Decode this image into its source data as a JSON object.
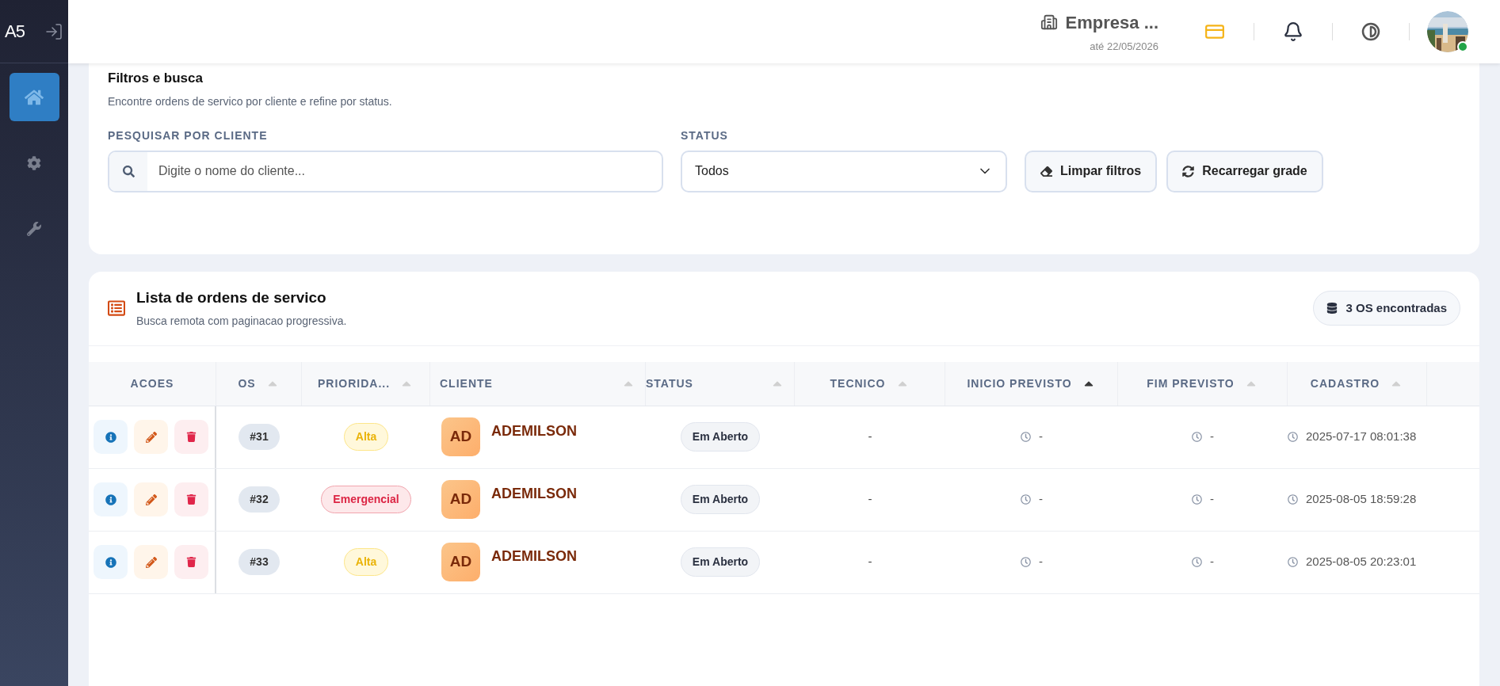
{
  "sidebar": {
    "logo": "A5",
    "items": [
      {
        "kind": "home",
        "selected": true
      },
      {
        "kind": "settings",
        "selected": false
      },
      {
        "kind": "tools",
        "selected": false
      }
    ]
  },
  "header": {
    "company": "Empresa ...",
    "valid_until": "até 22/05/2026",
    "user_online": true
  },
  "filters": {
    "title": "Filtros e busca",
    "subtitle": "Encontre ordens de servico por cliente e refine por status.",
    "search_label": "PESQUISAR POR CLIENTE",
    "search_placeholder": "Digite o nome do cliente...",
    "status_label": "STATUS",
    "status_value": "Todos",
    "buttons": [
      {
        "kind": "clear",
        "label": "Limpar filtros"
      },
      {
        "kind": "reload",
        "label": "Recarregar grade"
      }
    ]
  },
  "list": {
    "title": "Lista de ordens de servico",
    "subtitle": "Busca remota com paginacao progressiva.",
    "count": "3 OS encontradas",
    "columns": [
      {
        "label": "ACOES"
      },
      {
        "label": "OS",
        "sorted": false
      },
      {
        "label": "PRIORIDA...",
        "sorted": false
      },
      {
        "label": "CLIENTE",
        "sorted": false
      },
      {
        "label": "STATUS",
        "sorted": false
      },
      {
        "label": "TECNICO",
        "sorted": false
      },
      {
        "label": "INICIO PREVISTO",
        "sorted": true
      },
      {
        "label": "FIM PREVISTO",
        "sorted": false
      },
      {
        "label": "CADASTRO",
        "sorted": false
      }
    ],
    "rows": [
      {
        "os": "#31",
        "priority": {
          "label": "Alta",
          "kind": "high"
        },
        "initials": "AD",
        "client": "ADEMILSON",
        "status": "Em Aberto",
        "technician": "-",
        "start": "-",
        "end": "-",
        "created": "2025-07-17 08:01:38"
      },
      {
        "os": "#32",
        "priority": {
          "label": "Emergencial",
          "kind": "emergency"
        },
        "initials": "AD",
        "client": "ADEMILSON",
        "status": "Em Aberto",
        "technician": "-",
        "start": "-",
        "end": "-",
        "created": "2025-08-05 18:59:28"
      },
      {
        "os": "#33",
        "priority": {
          "label": "Alta",
          "kind": "high"
        },
        "initials": "AD",
        "client": "ADEMILSON",
        "status": "Em Aberto",
        "technician": "-",
        "start": "-",
        "end": "-",
        "created": "2025-08-05 20:23:01"
      }
    ]
  }
}
